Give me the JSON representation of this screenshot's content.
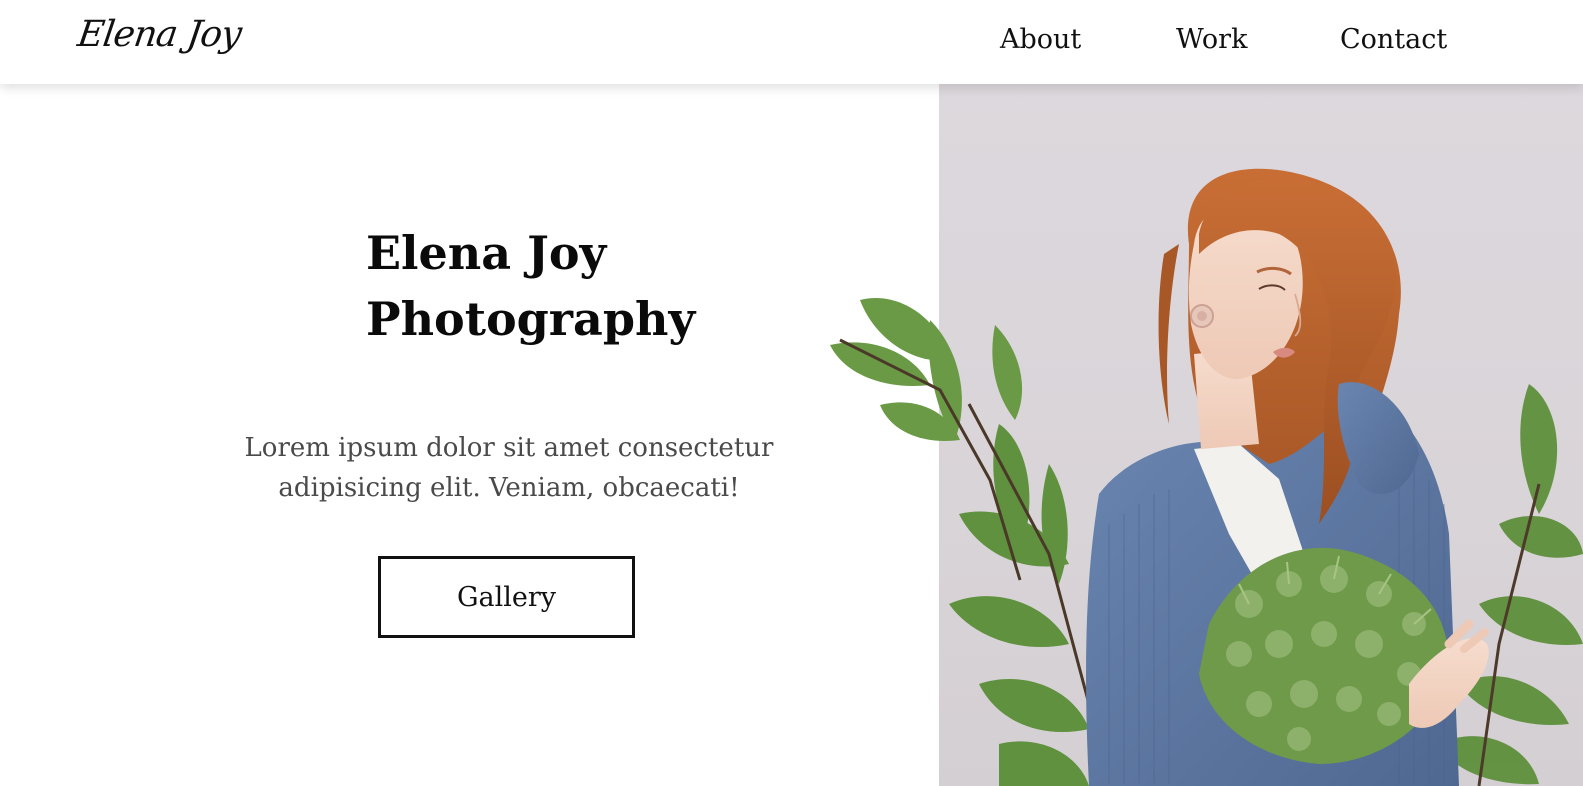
{
  "header": {
    "logo_text": "Elena Joy",
    "nav": {
      "about": "About",
      "work": "Work",
      "contact": "Contact"
    }
  },
  "hero": {
    "title_line1": "Elena Joy",
    "title_line2": "Photography",
    "description": "Lorem ipsum dolor sit amet consectetur adipisicing elit. Veniam, obcaecati!",
    "gallery_button": "Gallery"
  },
  "colors": {
    "text": "#111111",
    "muted_text": "#4a4a4a",
    "photo_background": "#dcd8dd",
    "cardigan": "#5f7aa3",
    "hair": "#b8622e",
    "leaf": "#5b8a3a"
  },
  "icons": {
    "hero_image": "woman-holding-flowers-photo"
  }
}
